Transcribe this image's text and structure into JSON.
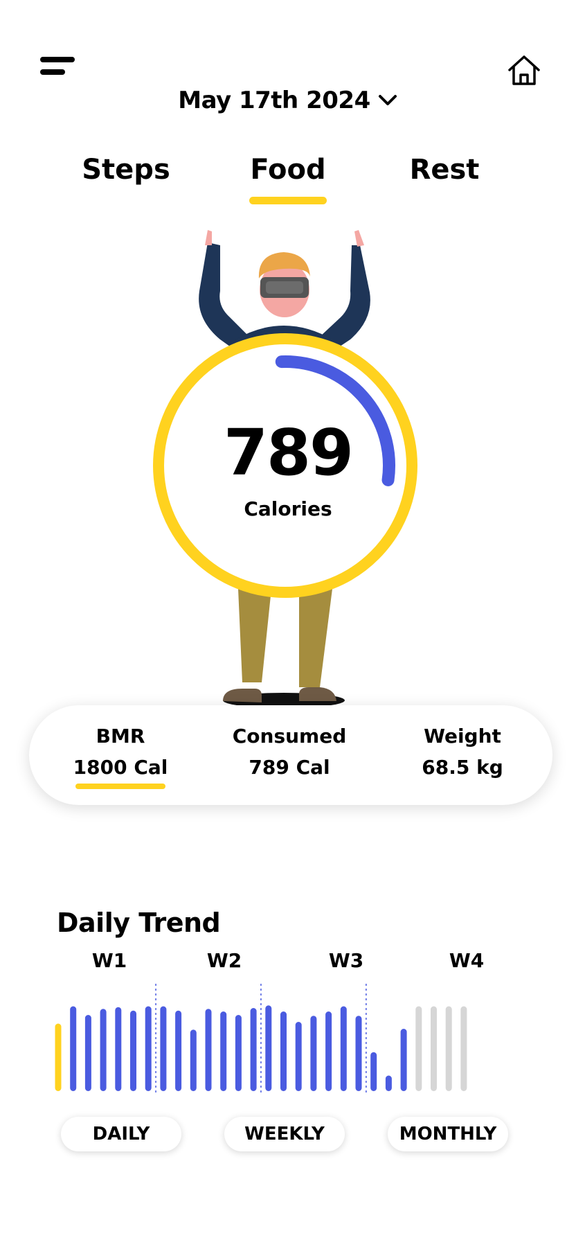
{
  "header": {
    "date": "May 17th 2024",
    "menu_icon": "menu-icon",
    "home_icon": "home-icon",
    "dropdown_icon": "chevron-down-icon"
  },
  "tabs": [
    {
      "label": "Steps",
      "active": false
    },
    {
      "label": "Food",
      "active": true
    },
    {
      "label": "Rest",
      "active": false
    }
  ],
  "calories": {
    "value": "789",
    "label": "Calories"
  },
  "stats": [
    {
      "label": "BMR",
      "value": "1800 Cal"
    },
    {
      "label": "Consumed",
      "value": "789 Cal"
    },
    {
      "label": "Weight",
      "value": "68.5 kg"
    }
  ],
  "trend": {
    "title": "Daily Trend",
    "weeks": [
      "W1",
      "W2",
      "W3",
      "W4"
    ],
    "periods": [
      "DAILY",
      "WEEKLY",
      "MONTHLY"
    ]
  },
  "chart_data": {
    "type": "bar",
    "values": [
      0.78,
      0.98,
      0.88,
      0.95,
      0.97,
      0.93,
      0.98,
      0.98,
      0.93,
      0.71,
      0.95,
      0.92,
      0.88,
      0.96,
      0.99,
      0.92,
      0.8,
      0.87,
      0.92,
      0.98,
      0.87,
      0.45,
      0.18,
      0.72,
      0.98,
      0.98,
      0.98,
      0.98
    ],
    "status": [
      "current",
      "past",
      "past",
      "past",
      "past",
      "past",
      "past",
      "past",
      "past",
      "past",
      "past",
      "past",
      "past",
      "past",
      "past",
      "past",
      "past",
      "past",
      "past",
      "past",
      "past",
      "past",
      "past",
      "past",
      "future",
      "future",
      "future",
      "future"
    ]
  },
  "colors": {
    "accent": "#FFD21F",
    "blue": "#4A5BE0",
    "future": "#D6D6D6"
  }
}
